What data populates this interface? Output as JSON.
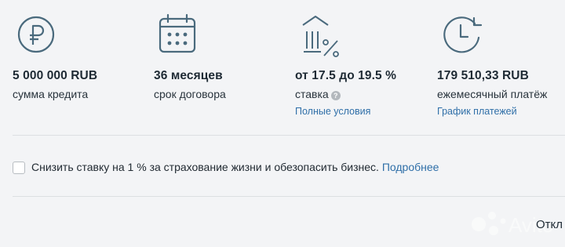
{
  "summary": [
    {
      "icon": "ruble-coin-icon",
      "value": "5 000 000 RUB",
      "label": "сумма кредита"
    },
    {
      "icon": "calendar-icon",
      "value": "36 месяцев",
      "label": "срок договора"
    },
    {
      "icon": "bank-percent-icon",
      "value": "от 17.5 до 19.5 %",
      "label": "ставка",
      "help": "?",
      "link": "Полные условия"
    },
    {
      "icon": "clock-refresh-icon",
      "value": "179 510,33 RUB",
      "label": "ежемесячный платёж",
      "link": "График платежей"
    }
  ],
  "insurance": {
    "checked": false,
    "text": "Снизить ставку на 1 % за страхование жизни и обезопасить бизнес.",
    "link": "Подробнее"
  },
  "footer": {
    "button_label": "Откл"
  },
  "colors": {
    "icon": "#4a6a7d",
    "link": "#2f6fa8",
    "background": "#f3f4f6"
  }
}
